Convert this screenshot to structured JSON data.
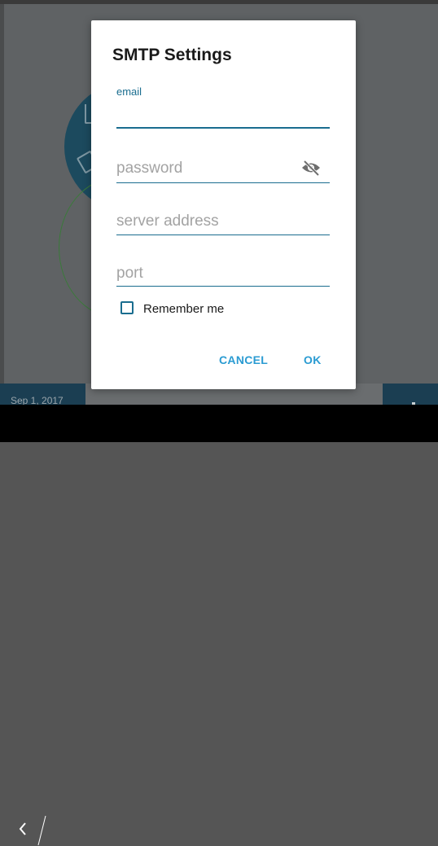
{
  "background": {
    "date": "Sep 1, 2017"
  },
  "dialog": {
    "title": "SMTP Settings",
    "email_label": "email",
    "email_value": "",
    "password_placeholder": "password",
    "server_placeholder": "server address",
    "port_placeholder": "port",
    "remember_label": "Remember me",
    "remember_checked": false,
    "cancel_label": "CANCEL",
    "ok_label": "OK"
  },
  "navbar": {
    "back_icon": "chevron-left-icon"
  },
  "colors": {
    "accent": "#1a6d8f",
    "button": "#2a9bd2",
    "scrim": "#5f6264"
  }
}
